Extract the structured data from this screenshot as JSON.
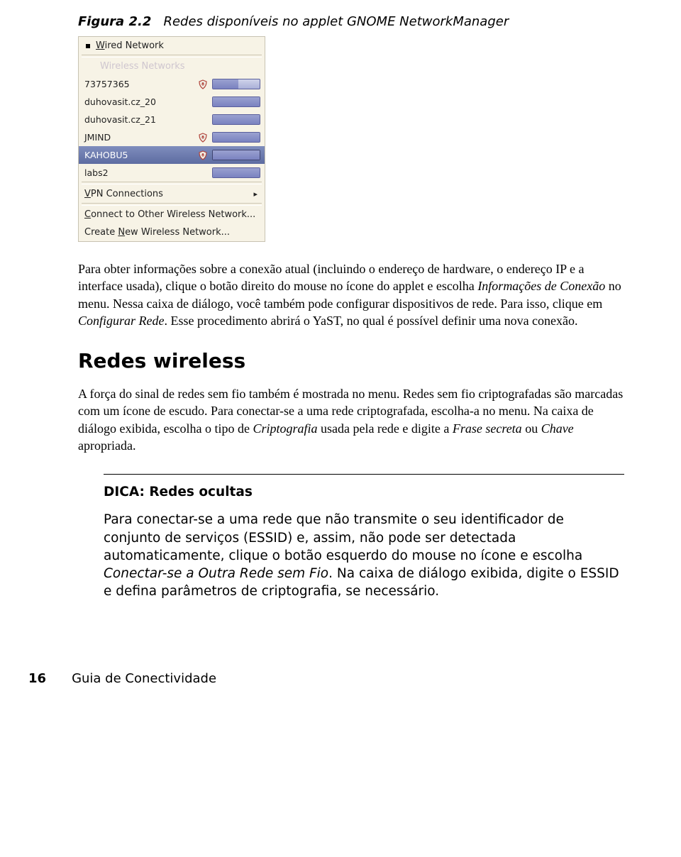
{
  "figure": {
    "label": "Figura 2.2",
    "caption": "Redes disponíveis no applet GNOME NetworkManager"
  },
  "applet": {
    "wired_label": "Wired Network",
    "wireless_header": "Wireless Networks",
    "networks": [
      {
        "name": "73757365",
        "shield": true,
        "signal": 0.55,
        "selected": false
      },
      {
        "name": "duhovasit.cz_20",
        "shield": false,
        "signal": 1.0,
        "selected": false
      },
      {
        "name": "duhovasit.cz_21",
        "shield": false,
        "signal": 1.0,
        "selected": false
      },
      {
        "name": "JMIND",
        "shield": true,
        "signal": 1.0,
        "selected": false
      },
      {
        "name": "KAHOBU5",
        "shield": true,
        "signal": 1.0,
        "selected": true
      },
      {
        "name": "labs2",
        "shield": false,
        "signal": 1.0,
        "selected": false
      }
    ],
    "vpn_label": "VPN Connections",
    "connect_other": "Connect to Other Wireless Network...",
    "create_new": "Create New Wireless Network..."
  },
  "p1_a": "Para obter informações sobre a conexão atual (incluindo o endereço de hardware, o endereço IP e a interface usada), clique o botão direito do mouse no ícone do applet e escolha ",
  "p1_i1": "Informações de Conexão",
  "p1_b": " no menu. Nessa caixa de diálogo, você também pode configurar dispositivos de rede. Para isso, clique em ",
  "p1_i2": "Configurar Rede",
  "p1_c": ". Esse procedimento abrirá o YaST, no qual é possível definir uma nova conexão.",
  "section_title": "Redes wireless",
  "p2_a": "A força do sinal de redes sem fio também é mostrada no menu. Redes sem fio criptografadas são marcadas com um ícone de escudo. Para conectar-se a uma rede criptografada, escolha-a no menu. Na caixa de diálogo exibida, escolha o tipo de ",
  "p2_i1": "Criptografia",
  "p2_b": " usada pela rede e digite a ",
  "p2_i2": "Frase secreta",
  "p2_c": " ou ",
  "p2_i3": "Chave",
  "p2_d": " apropriada.",
  "tip": {
    "title": "DICA: Redes ocultas",
    "a": "Para conectar-se a uma rede que não transmite o seu identificador de conjunto de serviços (ESSID) e, assim, não pode ser detectada automaticamente, clique o botão esquerdo do mouse no ícone e escolha ",
    "i1": "Conectar-se a Outra Rede sem Fio",
    "b": ". Na caixa de diálogo exibida, digite o ESSID e defina parâmetros de criptografia, se necessário."
  },
  "footer": {
    "page": "16",
    "guide": "Guia de Conectividade"
  }
}
